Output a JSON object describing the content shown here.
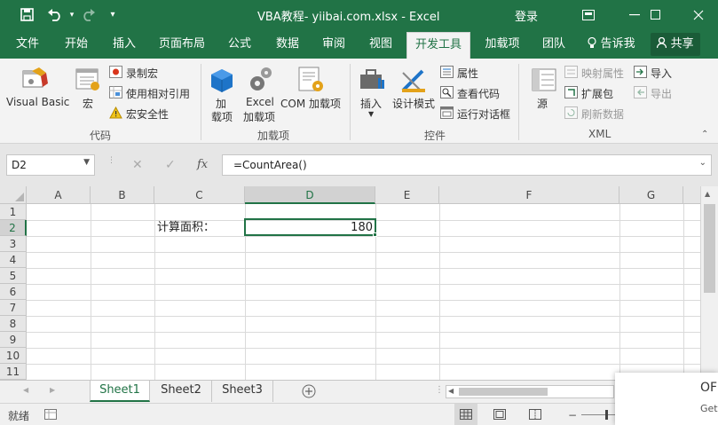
{
  "titlebar": {
    "title": "VBA教程- yiibai.com.xlsx - Excel",
    "login": "登录",
    "save_icon": "save-icon",
    "undo_icon": "undo-icon",
    "redo_icon": "redo-icon"
  },
  "tabs": [
    "文件",
    "开始",
    "插入",
    "页面布局",
    "公式",
    "数据",
    "审阅",
    "视图",
    "开发工具",
    "加载项",
    "团队"
  ],
  "tell_me": "告诉我",
  "share": "共享",
  "ribbon": {
    "code": {
      "label": "代码",
      "visual_basic": "Visual Basic",
      "macro": "宏",
      "record_macro": "录制宏",
      "relative_ref": "使用相对引用",
      "macro_security": "宏安全性"
    },
    "addins": {
      "label": "加载项",
      "add_1": "加",
      "add_2": "载项",
      "excel_1": "Excel",
      "excel_2": "加载项",
      "com": "COM 加载项"
    },
    "controls": {
      "label": "控件",
      "insert": "插入",
      "design_mode": "设计模式",
      "properties": "属性",
      "view_code": "查看代码",
      "run_dialog": "运行对话框"
    },
    "xml": {
      "label": "XML",
      "source": "源",
      "map_props": "映射属性",
      "expansion": "扩展包",
      "refresh": "刷新数据",
      "import": "导入",
      "export": "导出"
    }
  },
  "formula_bar": {
    "name_box": "D2",
    "cancel": "✕",
    "enter": "✓",
    "fx": "fx",
    "formula": "=CountArea()"
  },
  "columns": [
    "A",
    "B",
    "C",
    "D",
    "E",
    "F",
    "G"
  ],
  "rows": [
    "1",
    "2",
    "3",
    "4",
    "5",
    "6",
    "7",
    "8",
    "9",
    "10",
    "11"
  ],
  "cells": {
    "C2": "计算面积：",
    "D2": "180"
  },
  "sheets": [
    "Sheet1",
    "Sheet2",
    "Sheet3"
  ],
  "status": {
    "ready": "就绪"
  },
  "popup": {
    "line1": "OF",
    "line2": "Get"
  }
}
